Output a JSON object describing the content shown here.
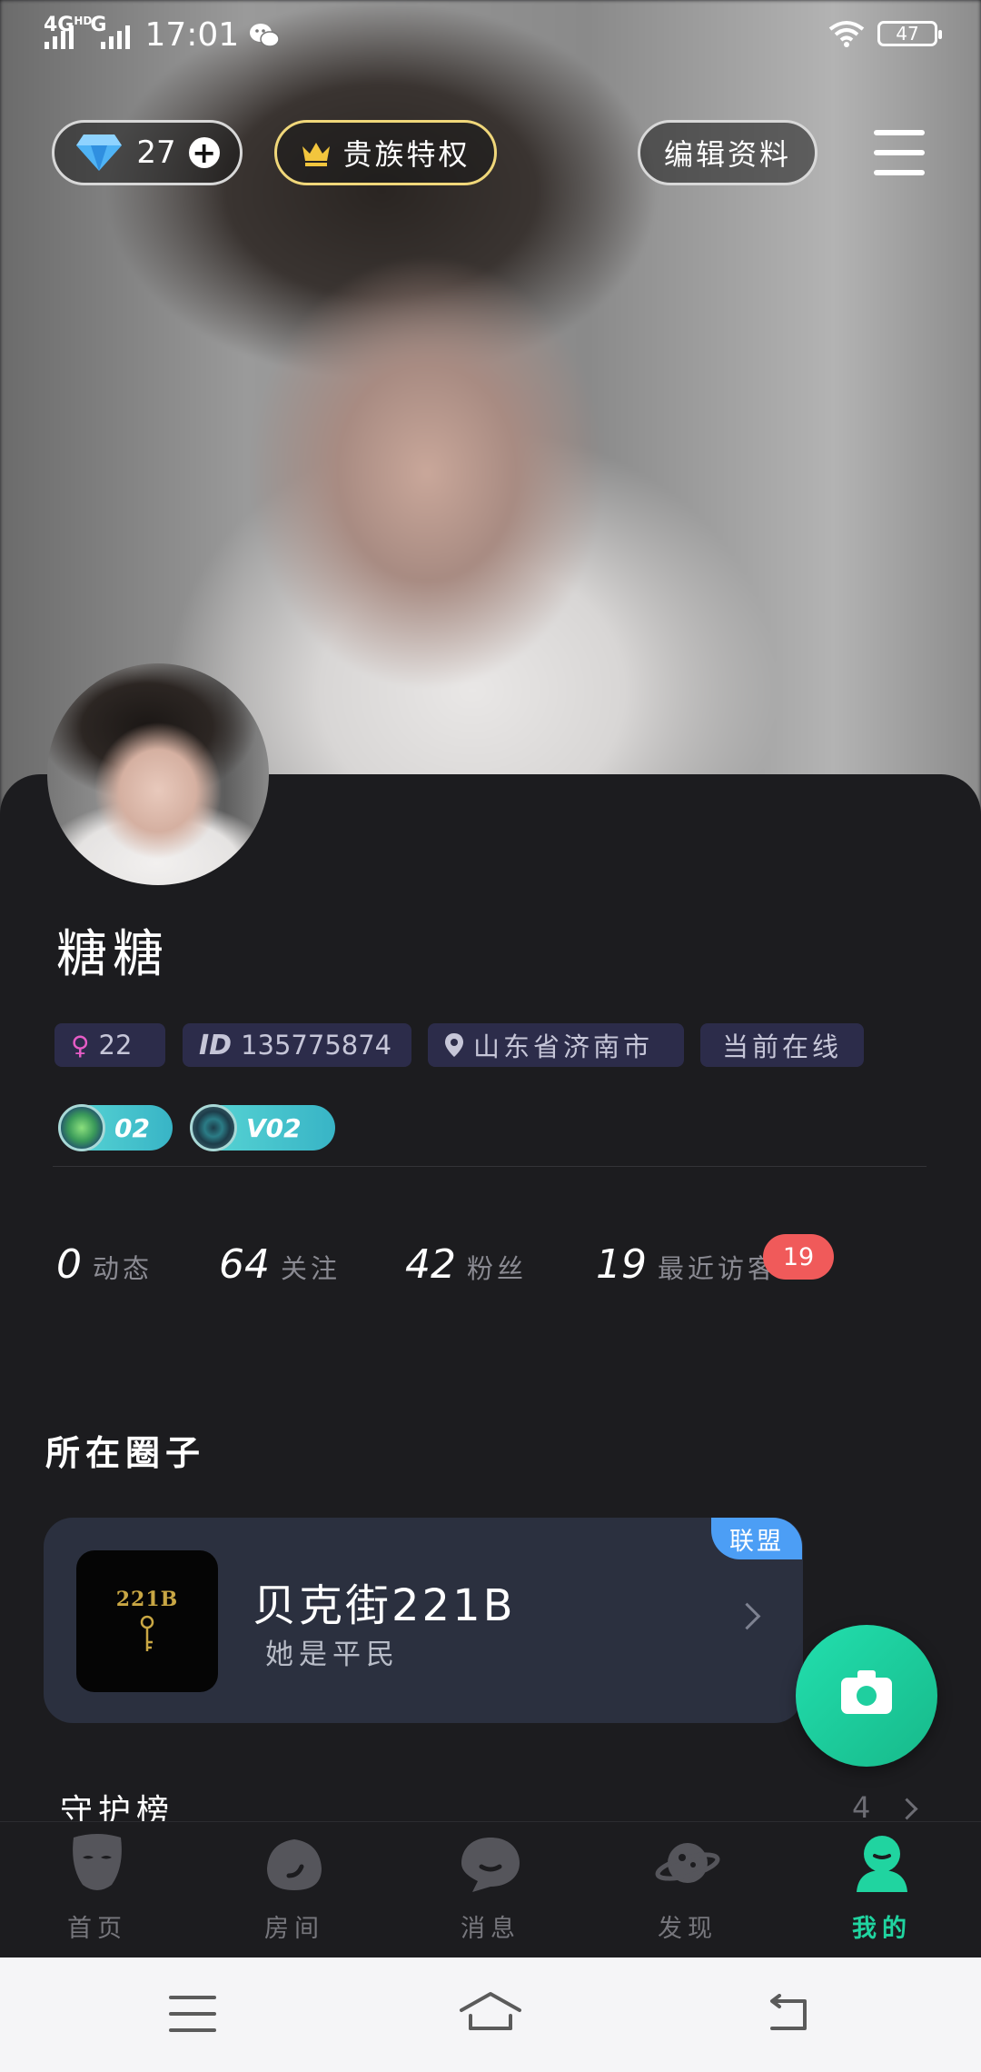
{
  "status_bar": {
    "network": "4G",
    "network_sup": "HD",
    "network2": "G",
    "time": "17:01",
    "battery": "47"
  },
  "header": {
    "diamond_count": "27",
    "noble_label": "贵族特权",
    "edit_label": "编辑资料"
  },
  "profile": {
    "name": "糖糖",
    "age": "22",
    "id_value": "135775874",
    "location": "山东省济南市",
    "online_status": "当前在线",
    "badge_level": "02",
    "vip_level": "V02"
  },
  "stats": [
    {
      "num": "0",
      "label": "动态"
    },
    {
      "num": "64",
      "label": "关注"
    },
    {
      "num": "42",
      "label": "粉丝"
    },
    {
      "num": "19",
      "label": "最近访客"
    }
  ],
  "visitor_badge": "19",
  "circle_section": {
    "title": "所在圈子",
    "tag": "联盟",
    "logo_text": "221B",
    "name": "贝克街221B",
    "role": "她是平民"
  },
  "guard": {
    "title": "守护榜",
    "count": "4"
  },
  "tabs": [
    {
      "label": "首页",
      "icon": "mask-icon"
    },
    {
      "label": "房间",
      "icon": "room-icon"
    },
    {
      "label": "消息",
      "icon": "message-icon"
    },
    {
      "label": "发现",
      "icon": "planet-icon"
    },
    {
      "label": "我的",
      "icon": "profile-icon"
    }
  ],
  "active_tab": "我的",
  "colors": {
    "accent": "#20d4a0",
    "visitor_badge": "#f05a5a",
    "alliance_tag": "#4c9ef5",
    "noble_border": "#f0d77a"
  }
}
